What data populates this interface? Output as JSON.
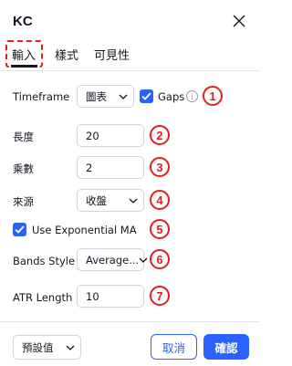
{
  "dialog": {
    "title": "KC",
    "tabs": [
      {
        "label": "輸入"
      },
      {
        "label": "樣式"
      },
      {
        "label": "可見性"
      }
    ]
  },
  "inputs": {
    "timeframe": {
      "label": "Timeframe",
      "value": "圖表",
      "gaps_label": "Gaps",
      "gaps_checked": true,
      "info_icon": "ⓘ"
    },
    "length": {
      "label": "長度",
      "value": "20"
    },
    "multiplier": {
      "label": "乘數",
      "value": "2"
    },
    "source": {
      "label": "來源",
      "value": "收盤"
    },
    "use_exp_ma": {
      "label": "Use Exponential MA",
      "checked": true
    },
    "bands_style": {
      "label": "Bands Style",
      "value": "Average..."
    },
    "atr_length": {
      "label": "ATR Length",
      "value": "10"
    }
  },
  "annotations": [
    "1",
    "2",
    "3",
    "4",
    "5",
    "6",
    "7"
  ],
  "footer": {
    "defaults_label": "預設值",
    "cancel_label": "取消",
    "ok_label": "確認"
  },
  "colors": {
    "accent": "#2962ff",
    "annotation": "#e0201e"
  }
}
